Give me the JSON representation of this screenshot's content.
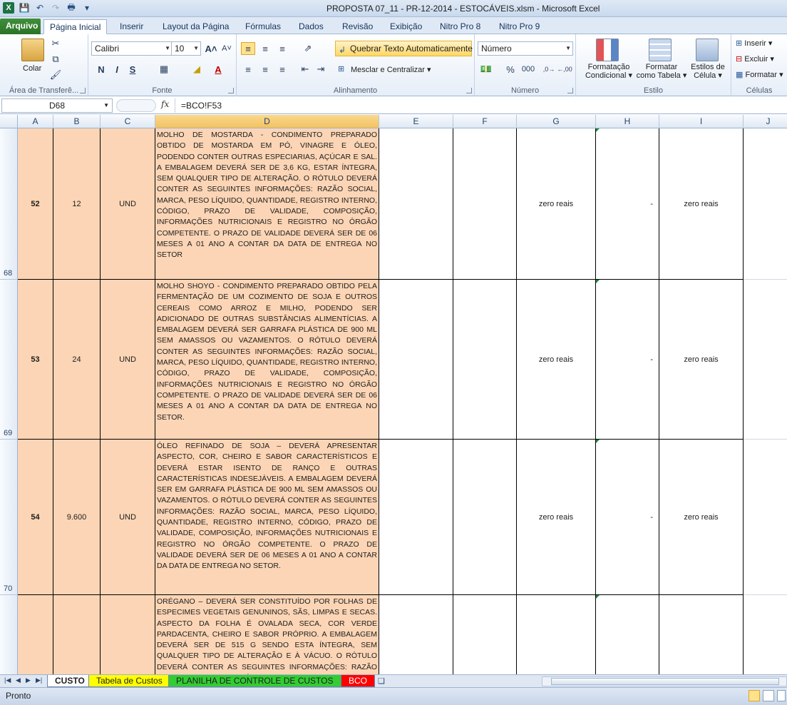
{
  "window": {
    "title": "PROPOSTA 07_11 - PR-12-2014 - ESTOCÁVEIS.xlsm  -  Microsoft Excel"
  },
  "ribbon": {
    "tabs": [
      "Arquivo",
      "Página Inicial",
      "Inserir",
      "Layout da Página",
      "Fórmulas",
      "Dados",
      "Revisão",
      "Exibição",
      "Nitro Pro 8",
      "Nitro Pro 9"
    ],
    "clipboard": {
      "paste": "Colar",
      "label": "Área de Transferê..."
    },
    "font": {
      "name": "Calibri",
      "size": "10",
      "bold": "N",
      "italic": "I",
      "underline": "S",
      "label": "Fonte"
    },
    "alignment": {
      "wrap_text": "Quebrar Texto Automaticamente",
      "merge_center": "Mesclar e Centralizar",
      "label": "Alinhamento"
    },
    "number": {
      "format": "Número",
      "percent": "%",
      "thousands": "000",
      "label": "Número"
    },
    "style": {
      "conditional": "Formatação",
      "conditional2": "Condicional",
      "as_table": "Formatar",
      "as_table2": "como Tabela",
      "cell_styles": "Estilos de",
      "cell_styles2": "Célula",
      "label": "Estilo"
    },
    "cells": {
      "insert": "Inserir",
      "delete": "Excluir",
      "format": "Formatar",
      "label": "Células"
    }
  },
  "formula_bar": {
    "name_box": "D68",
    "fx": "fx",
    "formula": "=BCO!F53"
  },
  "columns": [
    "A",
    "B",
    "C",
    "D",
    "E",
    "F",
    "G",
    "H",
    "I",
    "J"
  ],
  "rows": [
    {
      "row": "68",
      "a": "52",
      "b": "12",
      "c": "UND",
      "d": "MOLHO DE MOSTARDA - CONDIMENTO PREPARADO OBTIDO DE MOSTARDA EM PÓ, VINAGRE E ÓLEO, PODENDO CONTER OUTRAS ESPECIARIAS, AÇÚCAR E SAL. A EMBALAGEM DEVERÁ SER DE 3,6 KG, ESTAR ÍNTEGRA, SEM QUALQUER TIPO DE ALTERAÇÃO. O RÓTULO DEVERÁ CONTER AS SEGUINTES INFORMAÇÕES: RAZÃO SOCIAL, MARCA, PESO LÍQUIDO, QUANTIDADE, REGISTRO INTERNO, CÓDIGO, PRAZO DE VALIDADE, COMPOSIÇÃO, INFORMAÇÕES NUTRICIONAIS E REGISTRO NO ÓRGÃO COMPETENTE. O PRAZO DE VALIDADE DEVERÁ SER DE 06 MESES A 01 ANO A CONTAR DA DATA DE ENTREGA NO SETOR",
      "g": "zero reais",
      "h": "-",
      "i": "zero reais"
    },
    {
      "row": "69",
      "a": "53",
      "b": "24",
      "c": "UND",
      "d": "MOLHO SHOYO - CONDIMENTO PREPARADO OBTIDO PELA FERMENTAÇÃO DE UM COZIMENTO DE SOJA E OUTROS CEREAIS COMO ARROZ E MILHO, PODENDO SER ADICIONADO DE OUTRAS SUBSTÂNCIAS ALIMENTÍCIAS. A EMBALAGEM DEVERÁ SER GARRAFA PLÁSTICA DE 900 ML SEM AMASSOS OU VAZAMENTOS. O RÓTULO DEVERÁ CONTER AS SEGUINTES INFORMAÇÕES: RAZÃO SOCIAL, MARCA, PESO LÍQUIDO, QUANTIDADE, REGISTRO INTERNO, CÓDIGO, PRAZO DE VALIDADE, COMPOSIÇÃO, INFORMAÇÕES NUTRICIONAIS E REGISTRO NO ÓRGÃO COMPETENTE. O PRAZO DE VALIDADE DEVERÁ SER DE 06 MESES A 01 ANO A CONTAR DA DATA DE ENTREGA NO SETOR.",
      "g": "zero reais",
      "h": "-",
      "i": "zero reais"
    },
    {
      "row": "70",
      "a": "54",
      "b": "9.600",
      "c": "UND",
      "d": "ÓLEO REFINADO DE SOJA – DEVERÁ APRESENTAR ASPECTO, COR, CHEIRO E SABOR CARACTERÍSTICOS E DEVERÁ ESTAR ISENTO DE RANÇO E OUTRAS CARACTERÍSTICAS INDESEJÁVEIS. A EMBALAGEM DEVERÁ SER EM GARRAFA PLÁSTICA DE 900 ML SEM AMASSOS OU VAZAMENTOS. O RÓTULO DEVERÁ CONTER AS SEGUINTES INFORMAÇÕES: RAZÃO SOCIAL, MARCA, PESO LÍQUIDO, QUANTIDADE, REGISTRO INTERNO, CÓDIGO, PRAZO DE VALIDADE, COMPOSIÇÃO, INFORMAÇÕES NUTRICIONAIS E REGISTRO NO ÓRGÃO COMPETENTE. O PRAZO DE VALIDADE DEVERÁ SER DE 06 MESES A 01 ANO A CONTAR DA DATA DE ENTREGA NO SETOR.",
      "g": "zero reais",
      "h": "-",
      "i": "zero reais"
    },
    {
      "row": "",
      "a": "",
      "b": "",
      "c": "",
      "d": "ORÉGANO – DEVERÁ SER CONSTITUÍDO POR FOLHAS DE ESPECIMES VEGETAIS GENUNINOS, SÃS, LIMPAS E SECAS. ASPECTO DA FOLHA É OVALADA SECA, COR VERDE PARDACENTA, CHEIRO E SABOR PRÓPRIO. A EMBALAGEM DEVERÁ SER DE 515 G SENDO ESTA ÍNTEGRA, SEM QUALQUER TIPO DE ALTERAÇÃO E À VÁCUO. O RÓTULO DEVERÁ CONTER AS SEGUINTES INFORMAÇÕES: RAZÃO SOCIAL, MARCA, PESO LÍQUIDO, QUANTIDADE, PRAZO DE",
      "g": "",
      "h": "",
      "i": ""
    }
  ],
  "sheets": [
    "CUSTO",
    "Tabela de Custos",
    "PLANILHA DE CONTROLE DE CUSTOS",
    "BCO"
  ],
  "status": {
    "ready": "Pronto"
  },
  "colors": {
    "peach": "#fbd5b5",
    "tab_yellow": "#ffff00",
    "tab_green": "#33cc33",
    "tab_red": "#ff0000",
    "file_tab": "#2c7427"
  }
}
